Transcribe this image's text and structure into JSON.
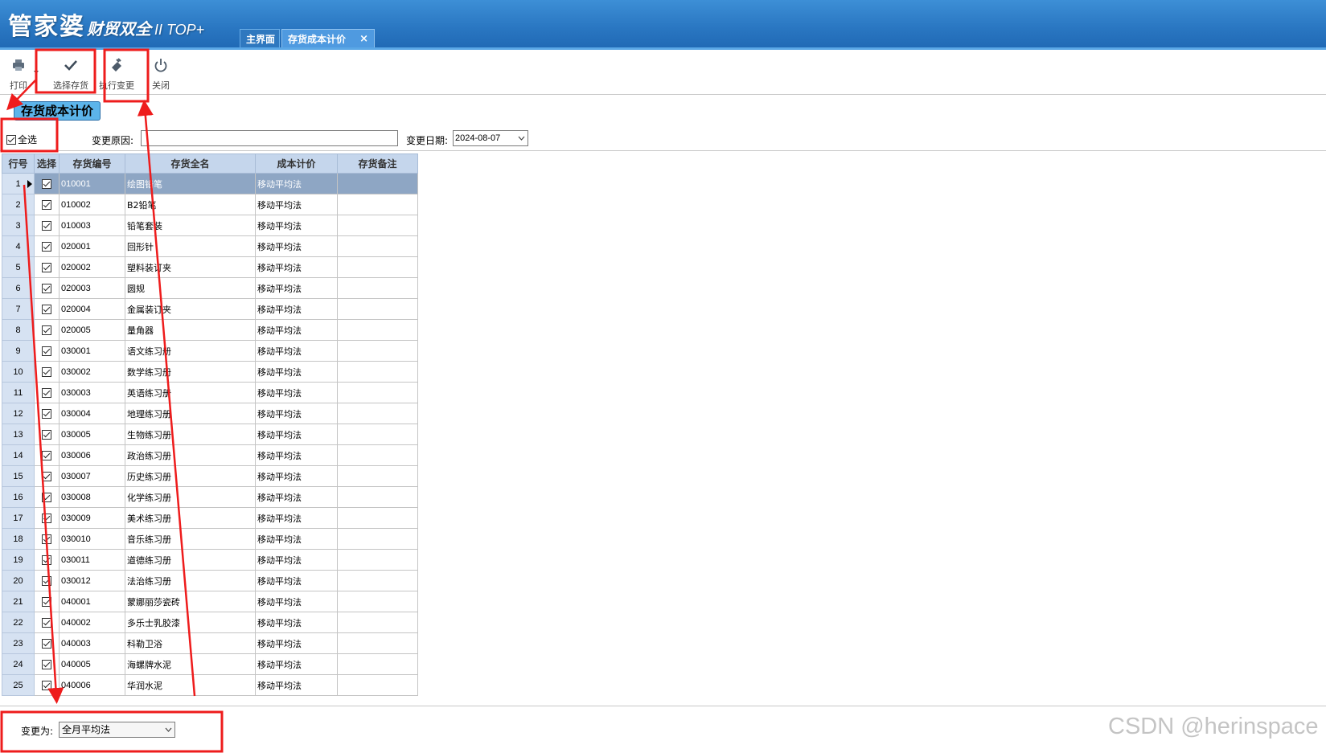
{
  "app": {
    "logo_main": "管家婆",
    "logo_sub": "财贸双全",
    "logo_version": "II TOP+"
  },
  "tabs": {
    "home": "主界面",
    "active": "存货成本计价",
    "close_glyph": "×"
  },
  "toolbar": {
    "print_label": "打印",
    "select_label": "选择存货",
    "execute_label": "执行变更",
    "close_label": "关闭"
  },
  "section_title": "存货成本计价",
  "filters": {
    "select_all_label": "全选",
    "select_all_checked": true,
    "reason_label": "变更原因:",
    "reason_value": "",
    "date_label": "变更日期:",
    "date_value": "2024-08-07"
  },
  "grid": {
    "columns": [
      "行号",
      "选择",
      "存货编号",
      "存货全名",
      "成本计价",
      "存货备注"
    ],
    "rows": [
      {
        "n": "1",
        "code": "010001",
        "name": "绘图铅笔",
        "method": "移动平均法",
        "note": ""
      },
      {
        "n": "2",
        "code": "010002",
        "name": "B2铅笔",
        "method": "移动平均法",
        "note": ""
      },
      {
        "n": "3",
        "code": "010003",
        "name": "铅笔套装",
        "method": "移动平均法",
        "note": ""
      },
      {
        "n": "4",
        "code": "020001",
        "name": "回形针",
        "method": "移动平均法",
        "note": ""
      },
      {
        "n": "5",
        "code": "020002",
        "name": "塑料装订夹",
        "method": "移动平均法",
        "note": ""
      },
      {
        "n": "6",
        "code": "020003",
        "name": "圆规",
        "method": "移动平均法",
        "note": ""
      },
      {
        "n": "7",
        "code": "020004",
        "name": "金属装订夹",
        "method": "移动平均法",
        "note": ""
      },
      {
        "n": "8",
        "code": "020005",
        "name": "量角器",
        "method": "移动平均法",
        "note": ""
      },
      {
        "n": "9",
        "code": "030001",
        "name": "语文练习册",
        "method": "移动平均法",
        "note": ""
      },
      {
        "n": "10",
        "code": "030002",
        "name": "数学练习册",
        "method": "移动平均法",
        "note": ""
      },
      {
        "n": "11",
        "code": "030003",
        "name": "英语练习册",
        "method": "移动平均法",
        "note": ""
      },
      {
        "n": "12",
        "code": "030004",
        "name": "地理练习册",
        "method": "移动平均法",
        "note": ""
      },
      {
        "n": "13",
        "code": "030005",
        "name": "生物练习册",
        "method": "移动平均法",
        "note": ""
      },
      {
        "n": "14",
        "code": "030006",
        "name": "政治练习册",
        "method": "移动平均法",
        "note": ""
      },
      {
        "n": "15",
        "code": "030007",
        "name": "历史练习册",
        "method": "移动平均法",
        "note": ""
      },
      {
        "n": "16",
        "code": "030008",
        "name": "化学练习册",
        "method": "移动平均法",
        "note": ""
      },
      {
        "n": "17",
        "code": "030009",
        "name": "美术练习册",
        "method": "移动平均法",
        "note": ""
      },
      {
        "n": "18",
        "code": "030010",
        "name": "音乐练习册",
        "method": "移动平均法",
        "note": ""
      },
      {
        "n": "19",
        "code": "030011",
        "name": "道德练习册",
        "method": "移动平均法",
        "note": ""
      },
      {
        "n": "20",
        "code": "030012",
        "name": "法治练习册",
        "method": "移动平均法",
        "note": ""
      },
      {
        "n": "21",
        "code": "040001",
        "name": "蒙娜丽莎瓷砖",
        "method": "移动平均法",
        "note": ""
      },
      {
        "n": "22",
        "code": "040002",
        "name": "多乐士乳胶漆",
        "method": "移动平均法",
        "note": ""
      },
      {
        "n": "23",
        "code": "040003",
        "name": "科勒卫浴",
        "method": "移动平均法",
        "note": ""
      },
      {
        "n": "24",
        "code": "040005",
        "name": "海螺牌水泥",
        "method": "移动平均法",
        "note": ""
      },
      {
        "n": "25",
        "code": "040006",
        "name": "华润水泥",
        "method": "移动平均法",
        "note": ""
      }
    ]
  },
  "bottom": {
    "change_to_label": "变更为:",
    "change_to_value": "全月平均法"
  },
  "watermark": "CSDN @herinspace",
  "colors": {
    "header_blue": "#2a77c2",
    "section_title_bg": "#5cb4ea",
    "grid_header_bg": "#c5d6ec",
    "row_number_bg": "#d6e2f2",
    "current_row_bg": "#8ea6c4",
    "annotation_red": "#ee1c1c"
  }
}
